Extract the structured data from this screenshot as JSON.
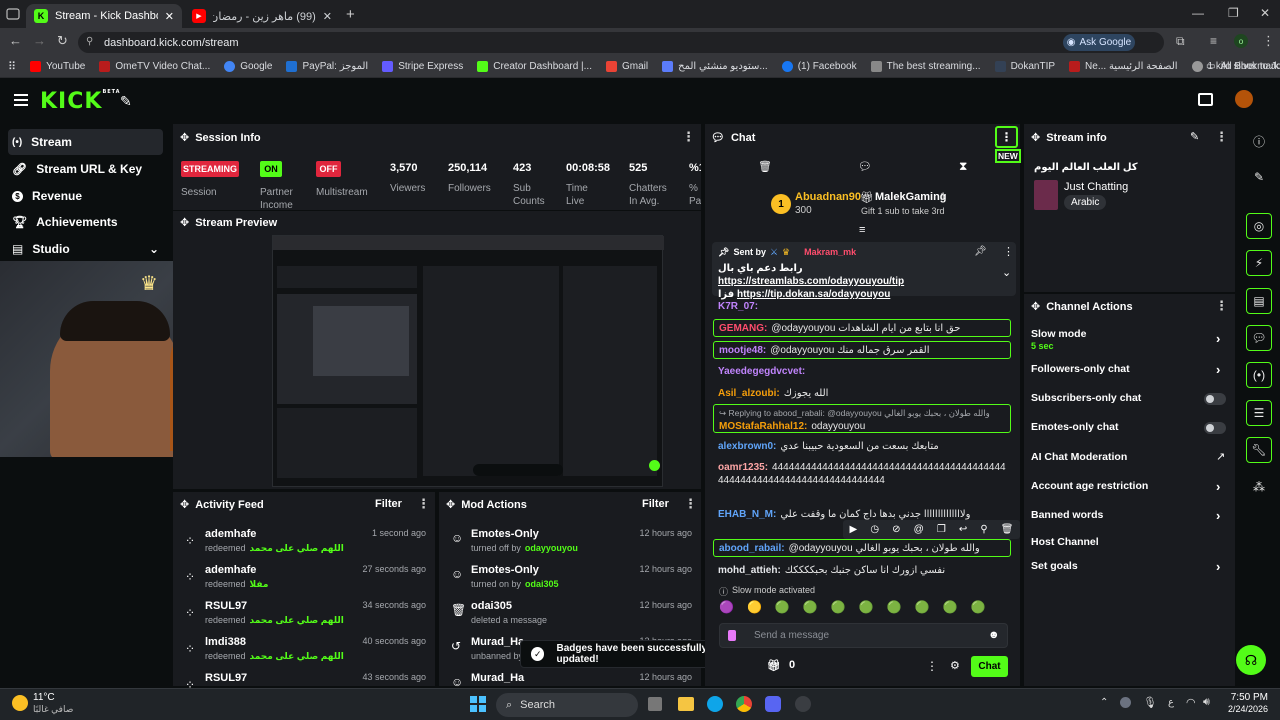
{
  "browser": {
    "tabs": [
      {
        "title": "Stream - Kick Dashboard",
        "active": true
      },
      {
        "title": "(99) ماهر زين - رمضان (عربي) |",
        "active": false
      }
    ],
    "url": "dashboard.kick.com/stream",
    "ask_google": "Ask Google",
    "bookmarks": [
      "YouTube",
      "OmeTV Video Chat...",
      "Google",
      "PayPal: الموجز",
      "Stripe Express",
      "Creator Dashboard |...",
      "Gmail",
      "ستوديو منشئي المح...",
      "(1) Facebook",
      "The best streaming...",
      "DokanTIP",
      "Ne... الصفحة الرئيسية",
      "1 kilo silver to Jorda..."
    ],
    "all_bookmarks": "All Bookmarks"
  },
  "kick": {
    "logo": "KICK",
    "logo_beta": "BETA",
    "sidebar": [
      {
        "label": "Stream",
        "selected": true
      },
      {
        "label": "Stream URL & Key"
      },
      {
        "label": "Revenue"
      },
      {
        "label": "Achievements"
      },
      {
        "label": "Studio"
      }
    ]
  },
  "session": {
    "title": "Session Info",
    "badges": [
      {
        "text": "STREAMING",
        "label": "Session",
        "color": "#e0263d"
      },
      {
        "text": "ON",
        "label": "Partner Income",
        "color": "#53fc18"
      },
      {
        "text": "OFF",
        "label": "Multistream",
        "color": "#e0263d"
      }
    ],
    "stats": [
      {
        "value": "3,570",
        "label": "Viewers"
      },
      {
        "value": "250,114",
        "label": "Followers"
      },
      {
        "value": "423",
        "label": "Sub Counts"
      },
      {
        "value": "00:08:58",
        "label": "Time Live"
      },
      {
        "value": "525",
        "label": "Chatters In Avg."
      },
      {
        "value": "%1",
        "label": "% Pa"
      }
    ]
  },
  "preview": {
    "title": "Stream Preview"
  },
  "activity": {
    "title": "Activity Feed",
    "filter": "Filter",
    "items": [
      {
        "user": "ademhafe",
        "action": "redeemed",
        "reward": "اللهم صلي على محمد",
        "time": "1 second ago"
      },
      {
        "user": "ademhafe",
        "action": "redeemed",
        "reward": "مفلا",
        "time": "27 seconds ago"
      },
      {
        "user": "RSUL97",
        "action": "redeemed",
        "reward": "اللهم صلي على محمد",
        "time": "34 seconds ago"
      },
      {
        "user": "lmdi388",
        "action": "redeemed",
        "reward": "اللهم صلي على محمد",
        "time": "40 seconds ago"
      },
      {
        "user": "RSUL97",
        "action": "",
        "reward": "",
        "time": "43 seconds ago"
      }
    ]
  },
  "mod": {
    "title": "Mod Actions",
    "filter": "Filter",
    "items": [
      {
        "title": "Emotes-Only",
        "sub": "turned off by",
        "who": "odayyouyou",
        "time": "12 hours ago"
      },
      {
        "title": "Emotes-Only",
        "sub": "turned on by",
        "who": "odai305",
        "time": "12 hours ago"
      },
      {
        "title": "odai305",
        "sub": "deleted a message",
        "who": "",
        "time": "12 hours ago"
      },
      {
        "title": "Murad_Ha",
        "sub": "unbanned by",
        "who": "",
        "time": "12 hours ago"
      },
      {
        "title": "Murad_Ha",
        "sub": "",
        "who": "",
        "time": "12 hours ago"
      }
    ]
  },
  "toast": "Badges have been successfully updated!",
  "chat": {
    "title": "Chat",
    "new_label": "NEW",
    "leaders": [
      {
        "rank": "1",
        "name": "Abuadnan90",
        "count": "300"
      },
      {
        "name": "MalekGaming",
        "count": "1",
        "sub": "Gift 1 sub to take 3rd"
      }
    ],
    "pinned": {
      "sent_by": "Sent by",
      "user": "Makram_mk",
      "line1_prefix": "رابط دعم باي بال",
      "line1_url": "https://streamlabs.com/odayyouyou/tip",
      "line2_prefix": "فزا",
      "line2_url": "https://tip.dokan.sa/odayyouyou"
    },
    "messages": [
      {
        "user": "K7R_07:",
        "text": "",
        "color": "#c084fc",
        "boxed": false
      },
      {
        "user": "GEMANG:",
        "text": "@odayyouyou حق انا بتابع من ايام الشاهدات",
        "color": "#ff4d6d",
        "boxed": true
      },
      {
        "user": "mootje48:",
        "text": "@odayyouyou القمر سرق جماله منك",
        "color": "#c084fc",
        "boxed": true
      },
      {
        "user": "Yaeedegegdvcvet:",
        "text": "",
        "color": "#c084fc",
        "boxed": false
      },
      {
        "user": "Asil_alzoubi:",
        "text": "الله يجوزك",
        "color": "#f59e0b",
        "boxed": false
      },
      {
        "user": "MOStafaRahhal12:",
        "text": "odayyouyou",
        "color": "#f59e0b",
        "boxed": true,
        "reply": "Replying to abood_rabali: @odayyouyou والله طولان ، بحبك يوبو الغالي"
      },
      {
        "user": "alexbrown0:",
        "text": "متابعك بسعت من السعودية حبيبنا عدي",
        "color": "#60a5fa",
        "boxed": false
      },
      {
        "user": "oamr1235:",
        "text": "444444444444444444444444444444444444444444444444444444444444444444444444",
        "color": "#fca5a5",
        "boxed": false
      },
      {
        "user": "EHAB_N_M:",
        "text": "ولاااااااااااااا جدني بدها داج كمان ما وقفت علي",
        "color": "#60a5fa",
        "boxed": false
      },
      {
        "user": "abood_rabail:",
        "text": "@odayyouyou والله طولان ، بحبك يوبو الغالي",
        "color": "#60a5fa",
        "boxed": true
      },
      {
        "user": "mohd_attieh:",
        "text": "نفسي ازورك انا ساكن جنبك بحبككككك",
        "color": "#e5e7eb",
        "boxed": false
      }
    ],
    "slow_mode": "Slow mode activated",
    "placeholder": "Send a message",
    "points": "0",
    "send": "Chat"
  },
  "stream_info": {
    "title": "Stream info",
    "stream_title": "كل العلب العالم اليوم",
    "category": "Just Chatting",
    "tag": "Arabic"
  },
  "channel_actions": {
    "title": "Channel Actions",
    "items": [
      {
        "label": "Slow mode",
        "sub": "5 sec",
        "control": "chevron"
      },
      {
        "label": "Followers-only chat",
        "control": "chevron"
      },
      {
        "label": "Subscribers-only chat",
        "control": "toggle"
      },
      {
        "label": "Emotes-only chat",
        "control": "toggle"
      },
      {
        "label": "AI Chat Moderation",
        "control": "external"
      },
      {
        "label": "Account age restriction",
        "control": "chevron"
      },
      {
        "label": "Banned words",
        "control": "chevron"
      },
      {
        "label": "Host Channel",
        "control": "none"
      },
      {
        "label": "Set goals",
        "control": "chevron"
      }
    ]
  },
  "taskbar": {
    "weather_temp": "11°C",
    "weather_desc": "صافي غالبًا",
    "search": "Search",
    "time": "7:50 PM",
    "date": "2/24/2026",
    "lang": "ع"
  },
  "colors": {
    "accent": "#53fc18",
    "danger": "#e0263d",
    "panel": "#191b1f"
  }
}
